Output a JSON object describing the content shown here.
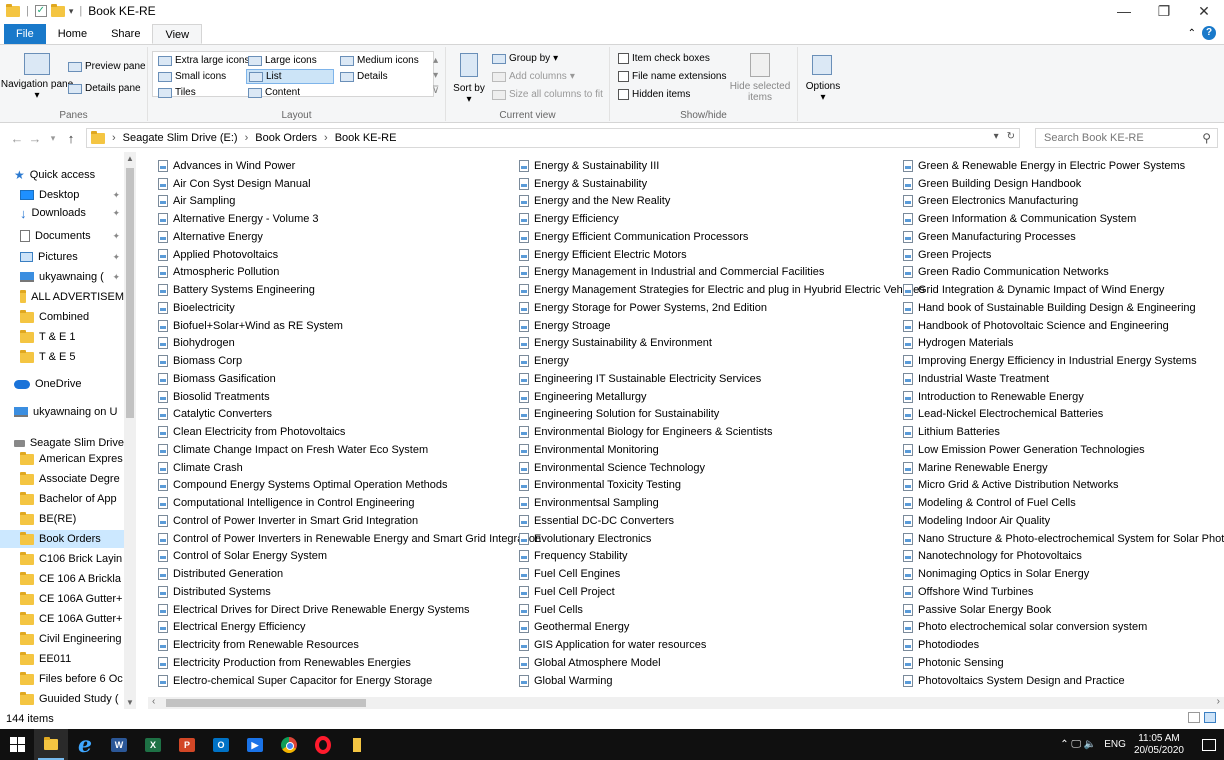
{
  "window": {
    "title": "Book KE-RE",
    "controls": [
      "—",
      "❐",
      "✕"
    ]
  },
  "ribbon_tabs": [
    "File",
    "Home",
    "Share",
    "View"
  ],
  "ribbon": {
    "panes": {
      "navigation_pane": "Navigation pane",
      "preview_pane": "Preview pane",
      "details_pane": "Details pane",
      "group_label": "Panes"
    },
    "layout": {
      "extra_large_icons": "Extra large icons",
      "large_icons": "Large icons",
      "medium_icons": "Medium icons",
      "small_icons": "Small icons",
      "list": "List",
      "details": "Details",
      "tiles": "Tiles",
      "content": "Content",
      "group_label": "Layout"
    },
    "current_view": {
      "sort_by": "Sort by",
      "group_by": "Group by",
      "add_columns": "Add columns",
      "size_all_columns": "Size all columns to fit",
      "group_label": "Current view"
    },
    "show_hide": {
      "item_check_boxes": "Item check boxes",
      "file_name_extensions": "File name extensions",
      "hidden_items": "Hidden items",
      "hide_selected_items": "Hide selected items",
      "group_label": "Show/hide"
    },
    "options": "Options"
  },
  "address": {
    "crumbs": [
      "Seagate Slim Drive (E:)",
      "Book Orders",
      "Book KE-RE"
    ],
    "search_placeholder": "Search Book KE-RE"
  },
  "nav": {
    "quick_access": "Quick access",
    "quick_items": [
      "Desktop",
      "Downloads",
      "Documents",
      "Pictures",
      "ukyawnaing (",
      "ALL ADVERTISEM",
      "Combined",
      "T & E 1",
      "T & E 5"
    ],
    "onedrive": "OneDrive",
    "this_pc": "ukyawnaing on U",
    "drive": "Seagate Slim Drive",
    "drive_items": [
      "American Expres",
      "Associate Degre",
      "Bachelor of App",
      "BE(RE)",
      "Book Orders",
      "C106 Brick Layin",
      "CE 106 A Brickla",
      "CE 106A Gutter+",
      "CE 106A Gutter+",
      "Civil Engineering",
      "EE011",
      "Files before 6 Oc",
      "Guuided Study ("
    ]
  },
  "files": {
    "col1": [
      "Advances in Wind Power",
      "Air Con Syst Design Manual",
      "Air Sampling",
      "Alternative Energy - Volume 3",
      "Alternative Energy",
      "Applied Photovoltaics",
      "Atmospheric Pollution",
      "Battery Systems Engineering",
      "Bioelectricity",
      "Biofuel+Solar+Wind as RE System",
      "Biohydrogen",
      "Biomass Corp",
      "Biomass Gasification",
      "Biosolid Treatments",
      "Catalytic Converters",
      "Clean Electricity from Photovoltaics",
      "Climate Change Impact on Fresh Water Eco System",
      "Climate Crash",
      "Compound Energy Systems Optimal Operation Methods",
      "Computational Intelligence in Control Engineering",
      "Control of Power Inverter in Smart Grid Integration",
      "Control of Power Inverters in Renewable Energy and Smart Grid Integration",
      "Control of Solar Energy System",
      "Distributed Generation",
      "Distributed Systems",
      "Electrical Drives for Direct Drive Renewable Energy Systems",
      "Electrical Energy Efficiency",
      "Electricity from Renewable Resources",
      "Electricity Production from Renewables Energies",
      "Electro-chemical Super Capacitor for Energy Storage"
    ],
    "col2": [
      "Energy & Sustainability III",
      "Energy & Sustainability",
      "Energy and the New Reality",
      "Energy Efficiency",
      "Energy Efficient Communication Processors",
      "Energy Efficient Electric Motors",
      "Energy Management in Industrial and Commercial Facilities",
      "Energy Management Strategies for Electric and plug in Hyubrid Electric Vehicles",
      "Energy Storage for Power Systems, 2nd Edition",
      "Energy Stroage",
      "Energy Sustainability & Environment",
      "Energy",
      "Engineering IT Sustainable Electricity Services",
      "Engineering Metallurgy",
      "Engineering Solution for Sustainability",
      "Environmental Biology for Engineers & Scientists",
      "Environmental Monitoring",
      "Environmental Science Technology",
      "Environmental Toxicity Testing",
      "Environmentsal Sampling",
      "Essential DC-DC Converters",
      "Evolutionary Electronics",
      "Frequency Stability",
      "Fuel Cell Engines",
      "Fuel Cell Project",
      "Fuel Cells",
      "Geothermal Energy",
      "GIS Application for water resources",
      "Global Atmosphere Model",
      "Global Warming"
    ],
    "col3": [
      "Green & Renewable Energy in Electric Power Systems",
      "Green Building Design Handbook",
      "Green Electronics Manufacturing",
      "Green Information & Communication System",
      "Green Manufacturing Processes",
      "Green Projects",
      "Green Radio Communication Networks",
      "Grid Integration & Dynamic Impact of Wind Energy",
      "Hand book of Sustainable Building Design & Engineering",
      "Handbook of Photovoltaic Science and Engineering",
      "Hydrogen Materials",
      "Improving Energy Efficiency in Industrial Energy Systems",
      "Industrial Waste Treatment",
      "Introduction to Renewable Energy",
      "Lead-Nickel Electrochemical Batteries",
      "Lithium Batteries",
      "Low Emission Power Generation Technologies",
      "Marine Renewable Energy",
      "Micro Grid & Active Distribution Networks",
      "Modeling & Control of Fuel Cells",
      "Modeling Indoor Air Quality",
      "Nano Structure & Photo-electrochemical System for Solar Photon C",
      "Nanotechnology for Photovoltaics",
      "Nonimaging Optics in Solar Energy",
      "Offshore Wind Turbines",
      "Passive Solar Energy Book",
      "Photo electrochemical solar conversion system",
      "Photodiodes",
      "Photonic Sensing",
      "Photovoltaics System Design and Practice"
    ]
  },
  "status": {
    "item_count": "144 items"
  },
  "taskbar": {
    "tray_lang": "ENG",
    "time": "11:05 AM",
    "date": "20/05/2020",
    "volume": "⌃ 🖵 🔈"
  }
}
